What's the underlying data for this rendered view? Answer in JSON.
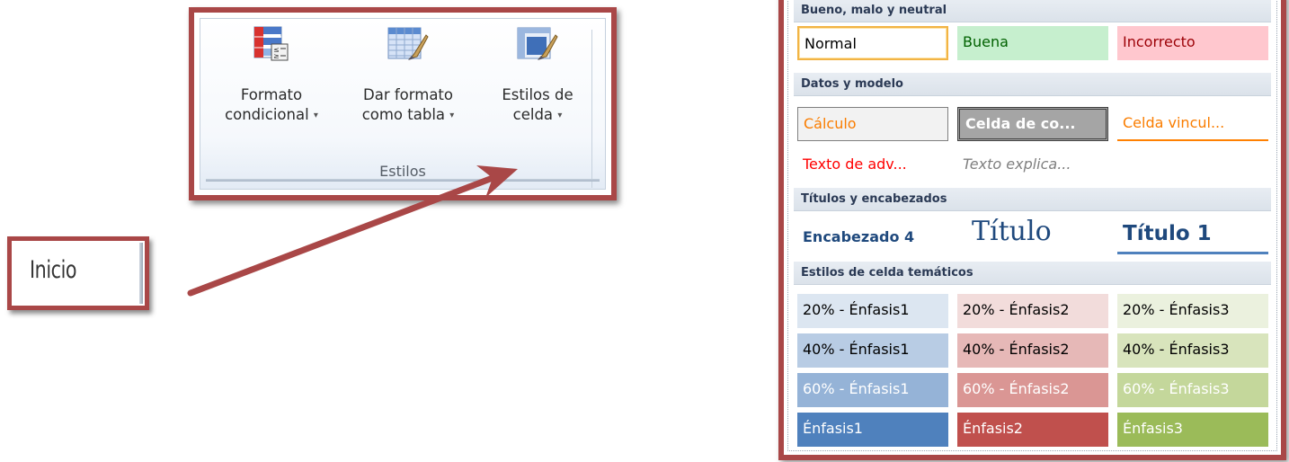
{
  "inicio": {
    "label": "Inicio"
  },
  "ribbon": {
    "group_label": "Estilos",
    "buttons": [
      {
        "line1": "Formato",
        "line2": "condicional",
        "caret": "▾",
        "icon": "conditional-format-icon"
      },
      {
        "line1": "Dar formato",
        "line2": "como tabla",
        "caret": "▾",
        "icon": "table-format-icon"
      },
      {
        "line1": "Estilos de",
        "line2": "celda",
        "caret": "▾",
        "icon": "cell-styles-icon"
      }
    ]
  },
  "gallery": {
    "sections": [
      "Bueno, malo y neutral",
      "Datos y modelo",
      "Títulos y encabezados",
      "Estilos de celda temáticos"
    ],
    "good_bad_neutral": [
      "Normal",
      "Buena",
      "Incorrecto"
    ],
    "data_model": [
      "Cálculo",
      "Celda de co...",
      "Celda vincul...",
      "Texto de adv...",
      "Texto explica..."
    ],
    "titles": [
      "Encabezado 4",
      "Título",
      "Título 1"
    ],
    "themed": {
      "row20": [
        "20% - Énfasis1",
        "20% - Énfasis2",
        "20% - Énfasis3"
      ],
      "row40": [
        "40% - Énfasis1",
        "40% - Énfasis2",
        "40% - Énfasis3"
      ],
      "row60": [
        "60% - Énfasis1",
        "60% - Énfasis2",
        "60% - Énfasis3"
      ],
      "rowfull": [
        "Énfasis1",
        "Énfasis2",
        "Énfasis3"
      ]
    }
  },
  "colors": {
    "callout_border": "#a94747",
    "accent1": "#4f81bd",
    "accent2": "#c0504d",
    "accent3": "#9bbb59"
  }
}
